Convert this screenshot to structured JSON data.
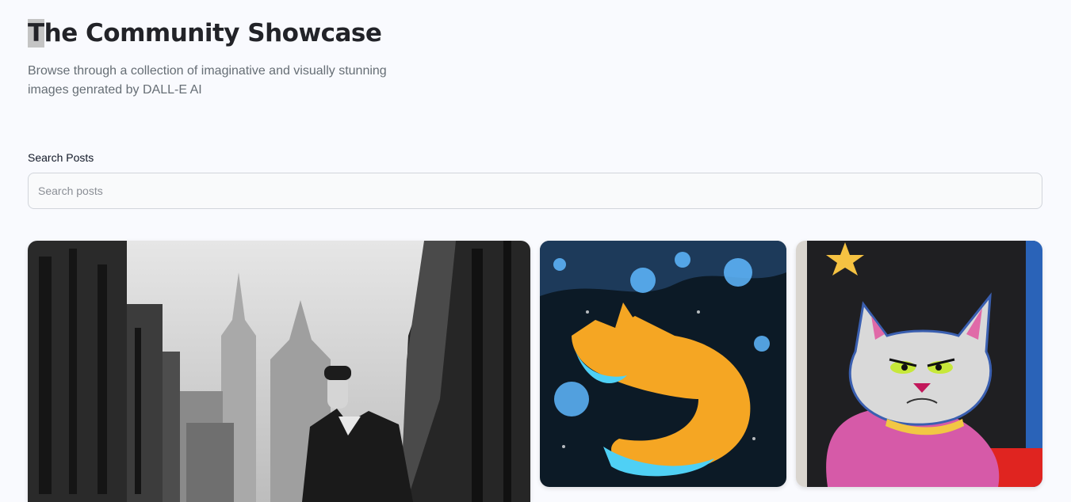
{
  "hero": {
    "title_first": "T",
    "title_rest": "he Community Showcase",
    "subtitle": "Browse through a collection of imaginative and visually stunning images genrated by DALL-E AI"
  },
  "search": {
    "label": "Search Posts",
    "placeholder": "Search posts",
    "value": ""
  },
  "gallery": {
    "cards": [
      {
        "subject": "black-and-white city street with man"
      },
      {
        "subject": "orange fox painting on starry background"
      },
      {
        "subject": "grumpy pink cat crayon drawing"
      }
    ]
  },
  "colors": {
    "background": "#f9fafe",
    "title": "#222328",
    "subtitle": "#666e75"
  }
}
